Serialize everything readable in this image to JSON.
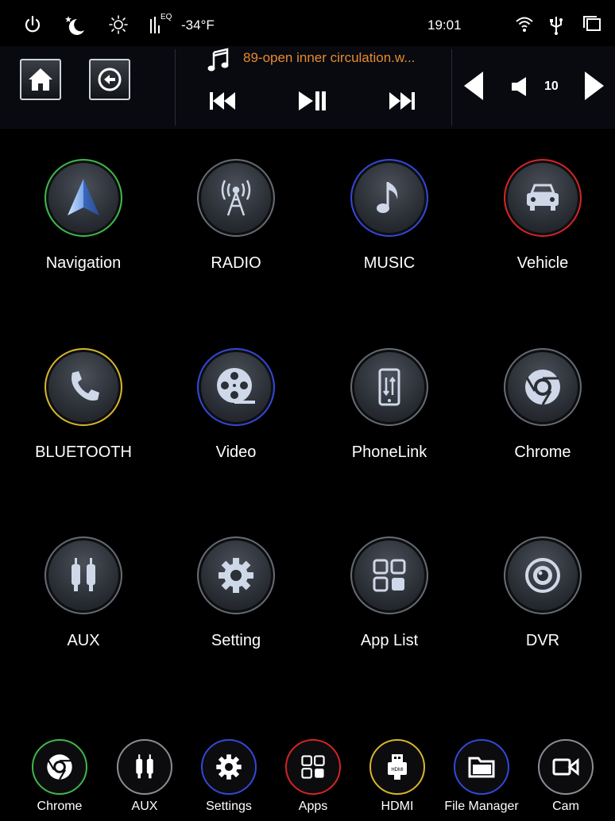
{
  "status_bar": {
    "temperature": "-34°F",
    "eq_label": "EQ",
    "time": "19:01"
  },
  "control_bar": {
    "track_title": "89-open inner circulation.w...",
    "volume": "10"
  },
  "apps": [
    {
      "label": "Navigation",
      "icon": "navigation-arrow-icon",
      "ring": "#3fb84a"
    },
    {
      "label": "RADIO",
      "icon": "radio-tower-icon",
      "ring": "#666b73"
    },
    {
      "label": "MUSIC",
      "icon": "music-note-icon",
      "ring": "#3348d8"
    },
    {
      "label": "Vehicle",
      "icon": "car-icon",
      "ring": "#d42424"
    },
    {
      "label": "BLUETOOTH",
      "icon": "phone-handset-icon",
      "ring": "#d8b62c"
    },
    {
      "label": "Video",
      "icon": "film-reel-icon",
      "ring": "#3348d8"
    },
    {
      "label": "PhoneLink",
      "icon": "phone-link-icon",
      "ring": "#666b73"
    },
    {
      "label": "Chrome",
      "icon": "chrome-icon",
      "ring": "#666b73"
    },
    {
      "label": "AUX",
      "icon": "aux-plug-icon",
      "ring": "#666b73"
    },
    {
      "label": "Setting",
      "icon": "gear-icon",
      "ring": "#666b73"
    },
    {
      "label": "App List",
      "icon": "app-grid-icon",
      "ring": "#666b73"
    },
    {
      "label": "DVR",
      "icon": "dvr-camera-icon",
      "ring": "#666b73"
    }
  ],
  "dock": [
    {
      "label": "Chrome",
      "icon": "chrome-icon",
      "ring": "#3fb84a"
    },
    {
      "label": "AUX",
      "icon": "aux-plug-icon",
      "ring": "#8a8d92"
    },
    {
      "label": "Settings",
      "icon": "gear-icon",
      "ring": "#3348d8"
    },
    {
      "label": "Apps",
      "icon": "app-grid-icon",
      "ring": "#d42424"
    },
    {
      "label": "HDMI",
      "icon": "hdmi-icon",
      "ring": "#d8b62c"
    },
    {
      "label": "File Manager",
      "icon": "folder-icon",
      "ring": "#3348d8"
    },
    {
      "label": "Cam",
      "icon": "video-camera-icon",
      "ring": "#8a8d92"
    }
  ]
}
